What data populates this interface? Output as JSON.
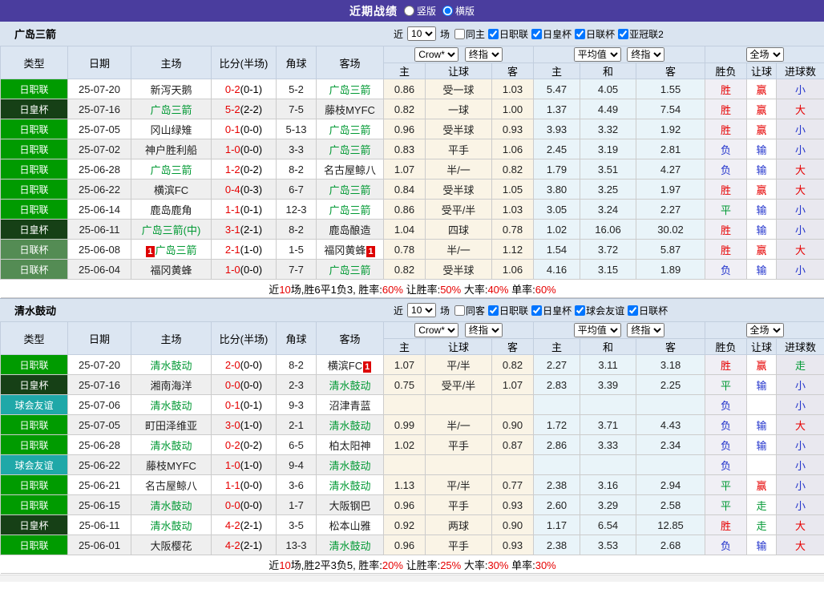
{
  "topbar": {
    "title": "近期战绩",
    "radios": [
      {
        "label": "竖版",
        "selected": false
      },
      {
        "label": "横版",
        "selected": true
      }
    ]
  },
  "filter_labels": {
    "near": "近",
    "games": "场"
  },
  "columns": {
    "type": "类型",
    "date": "日期",
    "home": "主场",
    "score": "比分(半场)",
    "corner": "角球",
    "away": "客场",
    "odds_home": "主",
    "odds_hcap": "让球",
    "odds_away": "客",
    "avg_home": "主",
    "avg_draw": "和",
    "avg_away": "客",
    "result_wl": "胜负",
    "result_hcap": "让球",
    "result_goals": "进球数"
  },
  "type_colors": {
    "日职联": "#009b00",
    "日皇杯": "#164016",
    "日联杯": "#548c54",
    "球会友谊": "#1fa8a8"
  },
  "result_colors": {
    "胜": "#e60000",
    "赢": "#e60000",
    "大": "#e60000",
    "平": "#009933",
    "走": "#009933",
    "负": "#2233cc",
    "输": "#2233cc",
    "小": "#2233cc"
  },
  "sections": [
    {
      "team": "广岛三箭",
      "filter": {
        "count": "10",
        "same_label": "同主",
        "same_checked": false,
        "leagues": [
          {
            "label": "日职联",
            "checked": true
          },
          {
            "label": "日皇杯",
            "checked": true
          },
          {
            "label": "日联杯",
            "checked": true
          },
          {
            "label": "亚冠联2",
            "checked": true
          }
        ]
      },
      "dropdowns": {
        "source": "Crow*",
        "time1": "终指",
        "avg": "平均值",
        "time2": "终指",
        "scope": "全场"
      },
      "rows": [
        {
          "type": "日职联",
          "date": "25-07-20",
          "home": "新泻天鹅",
          "home_hl": false,
          "score": "0-2",
          "half": "(0-1)",
          "corner": "5-2",
          "away": "广岛三箭",
          "away_hl": true,
          "h": "0.86",
          "hcap": "受一球",
          "a": "1.03",
          "avg_h": "5.47",
          "avg_d": "4.05",
          "avg_a": "1.55",
          "wl": "胜",
          "hc": "赢",
          "gl": "小"
        },
        {
          "type": "日皇杯",
          "date": "25-07-16",
          "home": "广岛三箭",
          "home_hl": true,
          "score": "5-2",
          "half": "(2-2)",
          "corner": "7-5",
          "away": "藤枝MYFC",
          "away_hl": false,
          "h": "0.82",
          "hcap": "一球",
          "a": "1.00",
          "avg_h": "1.37",
          "avg_d": "4.49",
          "avg_a": "7.54",
          "wl": "胜",
          "hc": "赢",
          "gl": "大"
        },
        {
          "type": "日职联",
          "date": "25-07-05",
          "home": "冈山绿雉",
          "home_hl": false,
          "score": "0-1",
          "half": "(0-0)",
          "corner": "5-13",
          "away": "广岛三箭",
          "away_hl": true,
          "h": "0.96",
          "hcap": "受半球",
          "a": "0.93",
          "avg_h": "3.93",
          "avg_d": "3.32",
          "avg_a": "1.92",
          "wl": "胜",
          "hc": "赢",
          "gl": "小"
        },
        {
          "type": "日职联",
          "date": "25-07-02",
          "home": "神户胜利船",
          "home_hl": false,
          "score": "1-0",
          "half": "(0-0)",
          "corner": "3-3",
          "away": "广岛三箭",
          "away_hl": true,
          "h": "0.83",
          "hcap": "平手",
          "a": "1.06",
          "avg_h": "2.45",
          "avg_d": "3.19",
          "avg_a": "2.81",
          "wl": "负",
          "hc": "输",
          "gl": "小"
        },
        {
          "type": "日职联",
          "date": "25-06-28",
          "home": "广岛三箭",
          "home_hl": true,
          "score": "1-2",
          "half": "(0-2)",
          "corner": "8-2",
          "away": "名古屋鲸八",
          "away_hl": false,
          "h": "1.07",
          "hcap": "半/一",
          "a": "0.82",
          "avg_h": "1.79",
          "avg_d": "3.51",
          "avg_a": "4.27",
          "wl": "负",
          "hc": "输",
          "gl": "大"
        },
        {
          "type": "日职联",
          "date": "25-06-22",
          "home": "横滨FC",
          "home_hl": false,
          "score": "0-4",
          "half": "(0-3)",
          "corner": "6-7",
          "away": "广岛三箭",
          "away_hl": true,
          "h": "0.84",
          "hcap": "受半球",
          "a": "1.05",
          "avg_h": "3.80",
          "avg_d": "3.25",
          "avg_a": "1.97",
          "wl": "胜",
          "hc": "赢",
          "gl": "大"
        },
        {
          "type": "日职联",
          "date": "25-06-14",
          "home": "鹿岛鹿角",
          "home_hl": false,
          "score": "1-1",
          "half": "(0-1)",
          "corner": "12-3",
          "away": "广岛三箭",
          "away_hl": true,
          "h": "0.86",
          "hcap": "受平/半",
          "a": "1.03",
          "avg_h": "3.05",
          "avg_d": "3.24",
          "avg_a": "2.27",
          "wl": "平",
          "hc": "输",
          "gl": "小"
        },
        {
          "type": "日皇杯",
          "date": "25-06-11",
          "home": "广岛三箭(中)",
          "home_hl": true,
          "score": "3-1",
          "half": "(2-1)",
          "corner": "8-2",
          "away": "鹿岛酿造",
          "away_hl": false,
          "h": "1.04",
          "hcap": "四球",
          "a": "0.78",
          "avg_h": "1.02",
          "avg_d": "16.06",
          "avg_a": "30.02",
          "wl": "胜",
          "hc": "输",
          "gl": "小"
        },
        {
          "type": "日联杯",
          "date": "25-06-08",
          "home": "广岛三箭",
          "home_hl": true,
          "home_badge": "1",
          "score": "2-1",
          "half": "(1-0)",
          "corner": "1-5",
          "away": "福冈黄蜂",
          "away_hl": false,
          "away_badge": "1",
          "h": "0.78",
          "hcap": "半/一",
          "a": "1.12",
          "avg_h": "1.54",
          "avg_d": "3.72",
          "avg_a": "5.87",
          "wl": "胜",
          "hc": "赢",
          "gl": "大"
        },
        {
          "type": "日联杯",
          "date": "25-06-04",
          "home": "福冈黄蜂",
          "home_hl": false,
          "score": "1-0",
          "half": "(0-0)",
          "corner": "7-7",
          "away": "广岛三箭",
          "away_hl": true,
          "h": "0.82",
          "hcap": "受半球",
          "a": "1.06",
          "avg_h": "4.16",
          "avg_d": "3.15",
          "avg_a": "1.89",
          "wl": "负",
          "hc": "输",
          "gl": "小"
        }
      ],
      "summary": [
        {
          "t": "近"
        },
        {
          "t": "10",
          "red": true
        },
        {
          "t": "场,胜6平1负3, 胜率:"
        },
        {
          "t": "60%",
          "red": true
        },
        {
          "t": " 让胜率:"
        },
        {
          "t": "50%",
          "red": true
        },
        {
          "t": " 大率:"
        },
        {
          "t": "40%",
          "red": true
        },
        {
          "t": " 单率:"
        },
        {
          "t": "60%",
          "red": true
        }
      ]
    },
    {
      "team": "清水鼓动",
      "filter": {
        "count": "10",
        "same_label": "同客",
        "same_checked": false,
        "leagues": [
          {
            "label": "日职联",
            "checked": true
          },
          {
            "label": "日皇杯",
            "checked": true
          },
          {
            "label": "球会友谊",
            "checked": true
          },
          {
            "label": "日联杯",
            "checked": true
          }
        ]
      },
      "dropdowns": {
        "source": "Crow*",
        "time1": "终指",
        "avg": "平均值",
        "time2": "终指",
        "scope": "全场"
      },
      "rows": [
        {
          "type": "日职联",
          "date": "25-07-20",
          "home": "清水鼓动",
          "home_hl": true,
          "score": "2-0",
          "half": "(0-0)",
          "corner": "8-2",
          "away": "横滨FC",
          "away_hl": false,
          "away_badge": "1",
          "h": "1.07",
          "hcap": "平/半",
          "a": "0.82",
          "avg_h": "2.27",
          "avg_d": "3.11",
          "avg_a": "3.18",
          "wl": "胜",
          "hc": "赢",
          "gl": "走"
        },
        {
          "type": "日皇杯",
          "date": "25-07-16",
          "home": "湘南海洋",
          "home_hl": false,
          "score": "0-0",
          "half": "(0-0)",
          "corner": "2-3",
          "away": "清水鼓动",
          "away_hl": true,
          "h": "0.75",
          "hcap": "受平/半",
          "a": "1.07",
          "avg_h": "2.83",
          "avg_d": "3.39",
          "avg_a": "2.25",
          "wl": "平",
          "hc": "输",
          "gl": "小"
        },
        {
          "type": "球会友谊",
          "date": "25-07-06",
          "home": "清水鼓动",
          "home_hl": true,
          "score": "0-1",
          "half": "(0-1)",
          "corner": "9-3",
          "away": "沼津青蓝",
          "away_hl": false,
          "h": "",
          "hcap": "",
          "a": "",
          "avg_h": "",
          "avg_d": "",
          "avg_a": "",
          "wl": "负",
          "hc": "",
          "gl": "小"
        },
        {
          "type": "日职联",
          "date": "25-07-05",
          "home": "町田泽维亚",
          "home_hl": false,
          "score": "3-0",
          "half": "(1-0)",
          "corner": "2-1",
          "away": "清水鼓动",
          "away_hl": true,
          "h": "0.99",
          "hcap": "半/一",
          "a": "0.90",
          "avg_h": "1.72",
          "avg_d": "3.71",
          "avg_a": "4.43",
          "wl": "负",
          "hc": "输",
          "gl": "大"
        },
        {
          "type": "日职联",
          "date": "25-06-28",
          "home": "清水鼓动",
          "home_hl": true,
          "score": "0-2",
          "half": "(0-2)",
          "corner": "6-5",
          "away": "柏太阳神",
          "away_hl": false,
          "h": "1.02",
          "hcap": "平手",
          "a": "0.87",
          "avg_h": "2.86",
          "avg_d": "3.33",
          "avg_a": "2.34",
          "wl": "负",
          "hc": "输",
          "gl": "小"
        },
        {
          "type": "球会友谊",
          "date": "25-06-22",
          "home": "藤枝MYFC",
          "home_hl": false,
          "score": "1-0",
          "half": "(1-0)",
          "corner": "9-4",
          "away": "清水鼓动",
          "away_hl": true,
          "h": "",
          "hcap": "",
          "a": "",
          "avg_h": "",
          "avg_d": "",
          "avg_a": "",
          "wl": "负",
          "hc": "",
          "gl": "小"
        },
        {
          "type": "日职联",
          "date": "25-06-21",
          "home": "名古屋鲸八",
          "home_hl": false,
          "score": "1-1",
          "half": "(0-0)",
          "corner": "3-6",
          "away": "清水鼓动",
          "away_hl": true,
          "h": "1.13",
          "hcap": "平/半",
          "a": "0.77",
          "avg_h": "2.38",
          "avg_d": "3.16",
          "avg_a": "2.94",
          "wl": "平",
          "hc": "赢",
          "gl": "小"
        },
        {
          "type": "日职联",
          "date": "25-06-15",
          "home": "清水鼓动",
          "home_hl": true,
          "score": "0-0",
          "half": "(0-0)",
          "corner": "1-7",
          "away": "大阪钢巴",
          "away_hl": false,
          "h": "0.96",
          "hcap": "平手",
          "a": "0.93",
          "avg_h": "2.60",
          "avg_d": "3.29",
          "avg_a": "2.58",
          "wl": "平",
          "hc": "走",
          "gl": "小"
        },
        {
          "type": "日皇杯",
          "date": "25-06-11",
          "home": "清水鼓动",
          "home_hl": true,
          "score": "4-2",
          "half": "(2-1)",
          "corner": "3-5",
          "away": "松本山雅",
          "away_hl": false,
          "h": "0.92",
          "hcap": "两球",
          "a": "0.90",
          "avg_h": "1.17",
          "avg_d": "6.54",
          "avg_a": "12.85",
          "wl": "胜",
          "hc": "走",
          "gl": "大"
        },
        {
          "type": "日职联",
          "date": "25-06-01",
          "home": "大阪樱花",
          "home_hl": false,
          "score": "4-2",
          "half": "(2-1)",
          "corner": "13-3",
          "away": "清水鼓动",
          "away_hl": true,
          "h": "0.96",
          "hcap": "平手",
          "a": "0.93",
          "avg_h": "2.38",
          "avg_d": "3.53",
          "avg_a": "2.68",
          "wl": "负",
          "hc": "输",
          "gl": "大"
        }
      ],
      "summary": [
        {
          "t": "近"
        },
        {
          "t": "10",
          "red": true
        },
        {
          "t": "场,胜2平3负5, 胜率:"
        },
        {
          "t": "20%",
          "red": true
        },
        {
          "t": " 让胜率:"
        },
        {
          "t": "25%",
          "red": true
        },
        {
          "t": " 大率:"
        },
        {
          "t": "30%",
          "red": true
        },
        {
          "t": " 单率:"
        },
        {
          "t": "30%",
          "red": true
        }
      ]
    }
  ]
}
